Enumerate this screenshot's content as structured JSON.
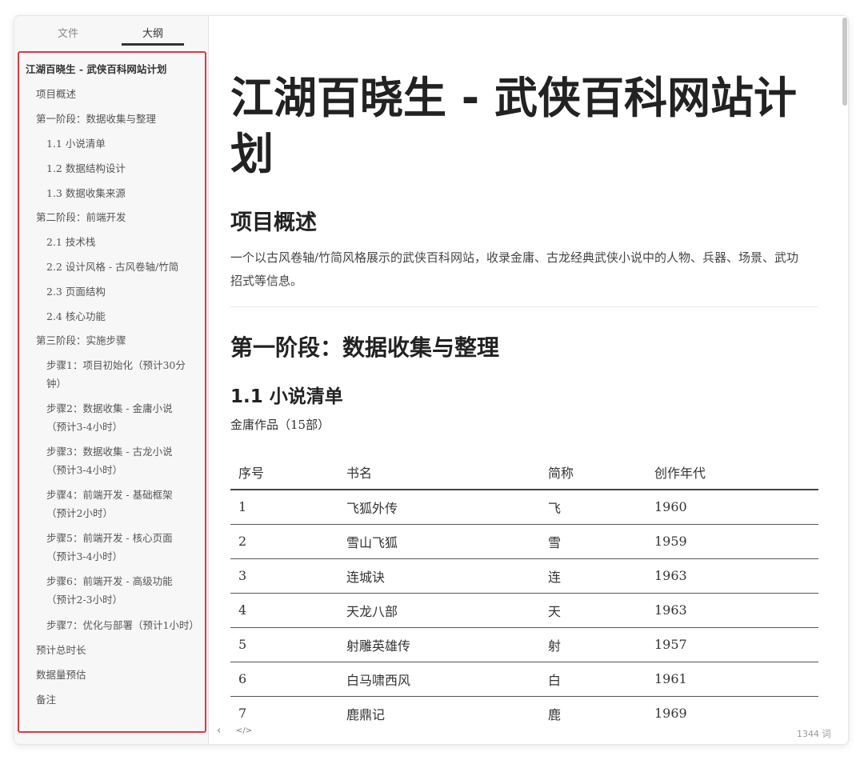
{
  "sidebar": {
    "tabs": {
      "files": "文件",
      "outline": "大纲"
    },
    "outline": [
      {
        "label": "江湖百晓生 - 武侠百科网站计划",
        "level": 1
      },
      {
        "label": "项目概述",
        "level": 2
      },
      {
        "label": "第一阶段：数据收集与整理",
        "level": 2
      },
      {
        "label": "1.1 小说清单",
        "level": 3
      },
      {
        "label": "1.2 数据结构设计",
        "level": 3
      },
      {
        "label": "1.3 数据收集来源",
        "level": 3
      },
      {
        "label": "第二阶段：前端开发",
        "level": 2
      },
      {
        "label": "2.1 技术栈",
        "level": 3
      },
      {
        "label": "2.2 设计风格 - 古风卷轴/竹简",
        "level": 3
      },
      {
        "label": "2.3 页面结构",
        "level": 3
      },
      {
        "label": "2.4 核心功能",
        "level": 3
      },
      {
        "label": "第三阶段：实施步骤",
        "level": 2
      },
      {
        "label": "步骤1：项目初始化（预计30分钟）",
        "level": 3
      },
      {
        "label": "步骤2：数据收集 - 金庸小说（预计3-4小时）",
        "level": 3
      },
      {
        "label": "步骤3：数据收集 - 古龙小说（预计3-4小时）",
        "level": 3
      },
      {
        "label": "步骤4：前端开发 - 基础框架（预计2小时）",
        "level": 3
      },
      {
        "label": "步骤5：前端开发 - 核心页面（预计3-4小时）",
        "level": 3
      },
      {
        "label": "步骤6：前端开发 - 高级功能（预计2-3小时）",
        "level": 3
      },
      {
        "label": "步骤7：优化与部署（预计1小时）",
        "level": 3
      },
      {
        "label": "预计总时长",
        "level": 2
      },
      {
        "label": "数据量预估",
        "level": 2
      },
      {
        "label": "备注",
        "level": 2
      }
    ]
  },
  "document": {
    "title": "江湖百晓生 - 武侠百科网站计划",
    "overview_heading": "项目概述",
    "overview_text": "一个以古风卷轴/竹简风格展示的武侠百科网站，收录金庸、古龙经典武侠小说中的人物、兵器、场景、武功招式等信息。",
    "phase1_heading": "第一阶段：数据收集与整理",
    "novels_heading": "1.1 小说清单",
    "jin_yong_label": "金庸作品（15部）",
    "table": {
      "headers": [
        "序号",
        "书名",
        "简称",
        "创作年代"
      ],
      "rows": [
        [
          "1",
          "飞狐外传",
          "飞",
          "1960"
        ],
        [
          "2",
          "雪山飞狐",
          "雪",
          "1959"
        ],
        [
          "3",
          "连城诀",
          "连",
          "1963"
        ],
        [
          "4",
          "天龙八部",
          "天",
          "1963"
        ],
        [
          "5",
          "射雕英雄传",
          "射",
          "1957"
        ],
        [
          "6",
          "白马啸西风",
          "白",
          "1961"
        ],
        [
          "7",
          "鹿鼎记",
          "鹿",
          "1969"
        ]
      ]
    }
  },
  "status": {
    "word_count": "1344 词",
    "back_icon": "chevron-left-icon",
    "source_icon": "code-icon"
  },
  "colors": {
    "highlight_border": "#e0383e",
    "sidebar_bg": "#f7f7f7"
  }
}
